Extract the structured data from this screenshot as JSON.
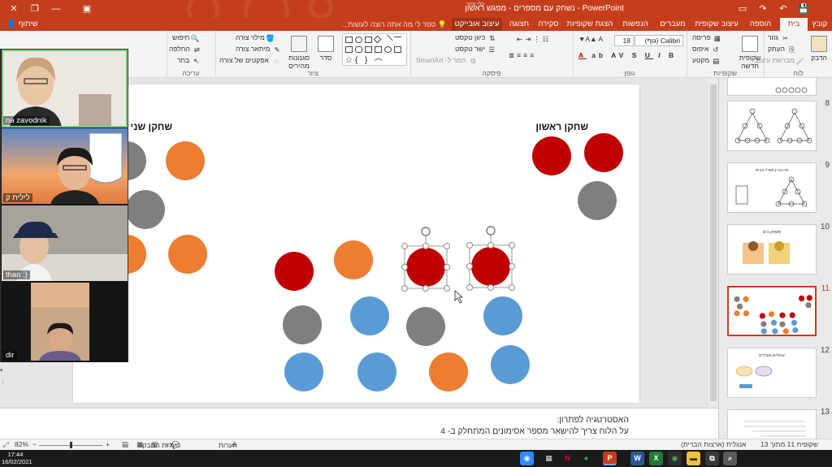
{
  "window": {
    "title": "PowerPoint - נשחק עם מספרים - מפגש ראשון",
    "share_label": "שיתוף",
    "tell_me_placeholder": "ספר לי מה אתה רוצה לעשות...",
    "context_group": "כלי ציור"
  },
  "tabs": [
    {
      "id": "file",
      "label": "קובץ"
    },
    {
      "id": "home",
      "label": "בית"
    },
    {
      "id": "insert",
      "label": "הוספה"
    },
    {
      "id": "design",
      "label": "עיצוב שקופית"
    },
    {
      "id": "transitions",
      "label": "מעברים"
    },
    {
      "id": "animations",
      "label": "הנפשות"
    },
    {
      "id": "slideshow",
      "label": "הצגת שקופיות"
    },
    {
      "id": "review",
      "label": "סקירה"
    },
    {
      "id": "view",
      "label": "תצוגה"
    },
    {
      "id": "format",
      "label": "עיצוב אובייקט"
    }
  ],
  "ribbon": {
    "clipboard": {
      "label": "לוח",
      "paste": "הדבק",
      "cut": "גזור",
      "copy": "העתק",
      "format_painter": "מברשת עיצוב"
    },
    "slides": {
      "label": "שקופיות",
      "new_slide": "שקופית חדשה",
      "layout": "פריסה",
      "reset": "איפוס",
      "section": "מקטע"
    },
    "font": {
      "label": "גופן",
      "font_name": "Calibri (גוף)",
      "font_size": "18"
    },
    "paragraph": {
      "label": "פיסקה",
      "text_direction": "כיוון טקסט",
      "align_text": "ישר טקסט",
      "smartart": "המר ל- SmartArt"
    },
    "drawing": {
      "label": "ציור",
      "arrange": "סדר",
      "quick_styles": "סגנונות מהירים",
      "shape_fill": "מילוי צורה",
      "shape_outline": "מיתאר צורה",
      "shape_effects": "אפקטים של צורה"
    },
    "editing": {
      "label": "עריכה",
      "find": "חיפוש",
      "replace": "החלפה",
      "select": "בחר"
    }
  },
  "slide": {
    "player1_label": "שחקן ראשון",
    "player2_label": "שחקן שני",
    "colors": {
      "red": "#c00000",
      "orange": "#ed7d31",
      "gray": "#7f7f7f",
      "blue": "#5b9bd5"
    }
  },
  "notes": {
    "line1": "האסטרטגיה לפתרון:",
    "line2": "על הלוח צריך להישאר מספר אסימונים המתחלק ב- 4"
  },
  "thumbnails": [
    {
      "num": "8",
      "title": ""
    },
    {
      "num": "9",
      "title": "זהו בניין מגדל בבית"
    },
    {
      "num": "10",
      "title": "משחק בים"
    },
    {
      "num": "11",
      "title": ""
    },
    {
      "num": "12",
      "title": "עיגולים ואוכלים"
    },
    {
      "num": "13",
      "title": ""
    }
  ],
  "status": {
    "slide_info": "שקופית 11 מתוך 13",
    "language": "אנגלית (ארצות הברית)",
    "notes_btn": "הערות",
    "comments_btn": "הערות המבקר",
    "zoom": "82%"
  },
  "video": {
    "participants": [
      {
        "name": "na zavodnik"
      },
      {
        "name": "לילית ק"
      },
      {
        "name": "than :)"
      },
      {
        "name": "dir"
      }
    ]
  },
  "taskbar": {
    "time": "17:44",
    "date": "16/02/2021"
  }
}
